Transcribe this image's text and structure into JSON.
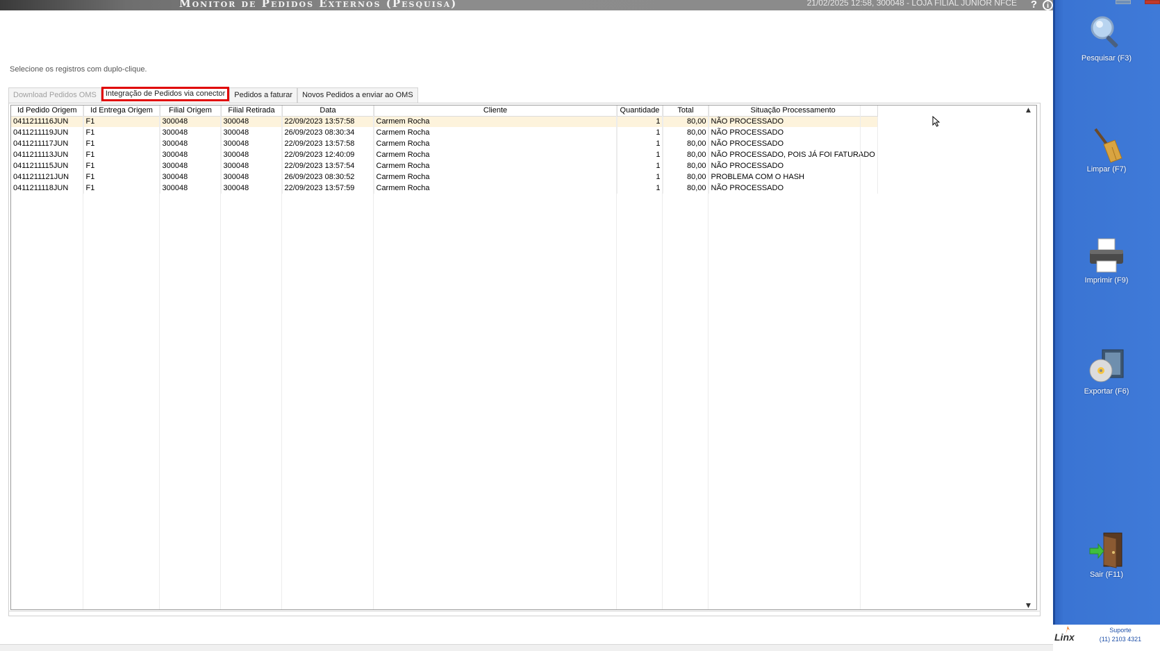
{
  "window": {
    "title": "Monitor de Pedidos Externos (Pesquisa)",
    "info": "21/02/2025 12:58, 300048 - LOJA FILIAL JUNIOR NFCE",
    "help_glyph": "?",
    "info_glyph": "i"
  },
  "instruction": "Selecione os registros com duplo-clique.",
  "tabs": [
    {
      "label": "Download Pedidos OMS",
      "state": "disabled"
    },
    {
      "label": "Integração de Pedidos via conector",
      "state": "active"
    },
    {
      "label": "Pedidos a faturar",
      "state": "normal"
    },
    {
      "label": "Novos Pedidos a enviar ao OMS",
      "state": "normal"
    }
  ],
  "grid": {
    "columns": [
      "Id Pedido Origem",
      "Id Entrega Origem",
      "Filial Origem",
      "Filial Retirada",
      "Data",
      "Cliente",
      "Quantidade",
      "Total",
      "Situação Processamento"
    ],
    "rows": [
      [
        "0411211116JUN",
        "F1",
        "300048",
        "300048",
        "22/09/2023 13:57:58",
        "Carmem Rocha",
        "1",
        "80,00",
        "NÃO PROCESSADO"
      ],
      [
        "0411211119JUN",
        "F1",
        "300048",
        "300048",
        "26/09/2023 08:30:34",
        "Carmem Rocha",
        "1",
        "80,00",
        "NÃO PROCESSADO"
      ],
      [
        "0411211117JUN",
        "F1",
        "300048",
        "300048",
        "22/09/2023 13:57:58",
        "Carmem Rocha",
        "1",
        "80,00",
        "NÃO PROCESSADO"
      ],
      [
        "0411211113JUN",
        "F1",
        "300048",
        "300048",
        "22/09/2023 12:40:09",
        "Carmem Rocha",
        "1",
        "80,00",
        "NÃO PROCESSADO, POIS JÁ FOI FATURADO"
      ],
      [
        "0411211115JUN",
        "F1",
        "300048",
        "300048",
        "22/09/2023 13:57:54",
        "Carmem Rocha",
        "1",
        "80,00",
        "NÃO PROCESSADO"
      ],
      [
        "0411211121JUN",
        "F1",
        "300048",
        "300048",
        "26/09/2023 08:30:52",
        "Carmem Rocha",
        "1",
        "80,00",
        "PROBLEMA COM O HASH"
      ],
      [
        "0411211118JUN",
        "F1",
        "300048",
        "300048",
        "22/09/2023 13:57:59",
        "Carmem Rocha",
        "1",
        "80,00",
        "NÃO PROCESSADO"
      ]
    ],
    "selected_row": 0
  },
  "sidebar": {
    "tools": [
      {
        "label": "Pesquisar (F3)",
        "icon": "magnifier-icon"
      },
      {
        "label": "Limpar (F7)",
        "icon": "broom-icon"
      },
      {
        "label": "Imprimir (F9)",
        "icon": "printer-icon"
      },
      {
        "label": "Exportar (F6)",
        "icon": "export-disc-icon"
      },
      {
        "label": "Sair (F11)",
        "icon": "exit-door-icon"
      }
    ],
    "brand": "Linx",
    "support_label": "Suporte",
    "support_phone": "(11) 2103 4321"
  },
  "colors": {
    "sidebar": "#3f7ad8",
    "selected_row": "#fdf3dc",
    "active_tab_border": "#e00000"
  }
}
